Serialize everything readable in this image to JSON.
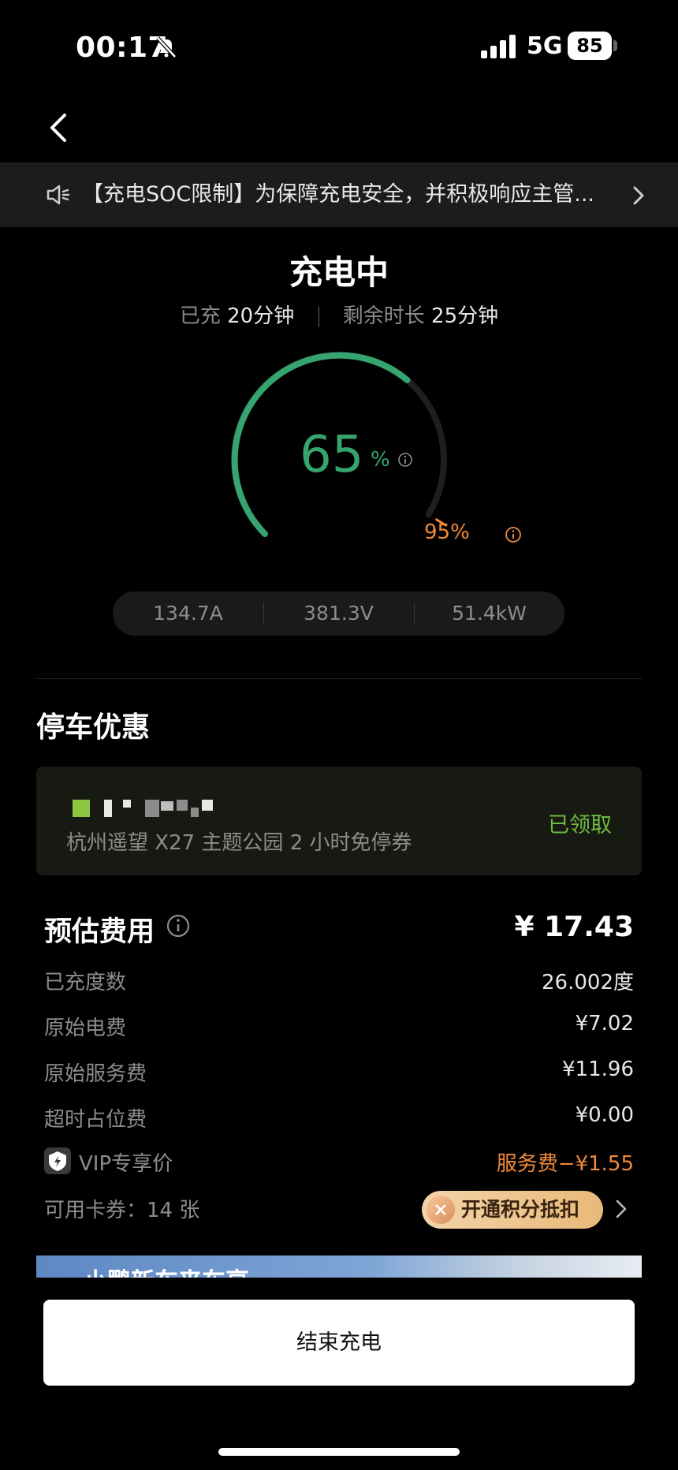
{
  "status_bar": {
    "time": "00:17",
    "network": "5G",
    "battery": "85"
  },
  "notice": {
    "text": "【充电SOC限制】为保障充电安全，并积极响应主管..."
  },
  "charging": {
    "title": "充电中",
    "charged_label": "已充",
    "charged_value": "20分钟",
    "remaining_label": "剩余时长",
    "remaining_value": "25分钟",
    "percent": "65",
    "percent_unit": "%",
    "limit": "95%",
    "level_fraction": 0.65,
    "limit_fraction": 0.95,
    "metrics": {
      "current": "134.7A",
      "voltage": "381.3V",
      "power": "51.4kW"
    }
  },
  "parking": {
    "title": "停车优惠",
    "coupon_desc": "杭州遥望 X27 主题公园 2 小时免停券",
    "coupon_status": "已领取"
  },
  "fee": {
    "title": "预估费用",
    "total": "¥ 17.43",
    "rows": [
      {
        "label": "已充度数",
        "value": "26.002度"
      },
      {
        "label": "原始电费",
        "value": "¥7.02"
      },
      {
        "label": "原始服务费",
        "value": "¥11.96"
      },
      {
        "label": "超时占位费",
        "value": "¥0.00"
      }
    ],
    "vip_label": "VIP专享价",
    "vip_value": "服务费−¥1.55",
    "cards_label": "可用卡券：14 张",
    "points_button": "开通积分抵扣"
  },
  "banner": {
    "text": "小鹏新车来车享"
  },
  "end_button": "结束充电",
  "colors": {
    "accent_green": "#35a46e",
    "warning_orange": "#f08a3a",
    "claimed_green": "#6fbb3f"
  }
}
